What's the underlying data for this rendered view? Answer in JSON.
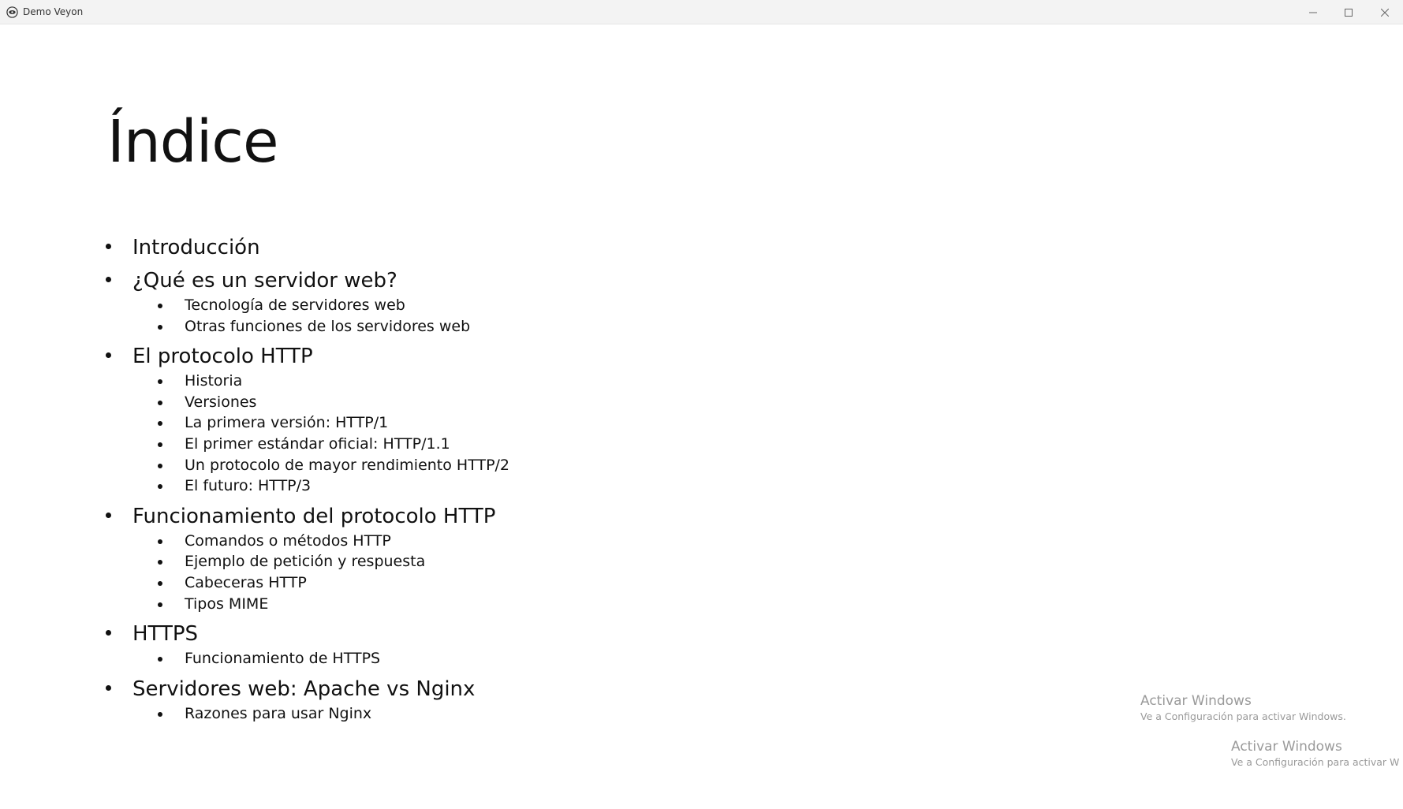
{
  "window": {
    "title": "Demo Veyon",
    "controls": {
      "minimize_icon": "minimize-icon",
      "maximize_icon": "maximize-icon",
      "close_icon": "close-icon"
    }
  },
  "slide": {
    "title": "Índice",
    "items": [
      {
        "label": "Introducción",
        "children": []
      },
      {
        "label": "¿Qué es un servidor web?",
        "children": [
          "Tecnología de servidores web",
          "Otras funciones de los servidores web"
        ]
      },
      {
        "label": "El protocolo HTTP",
        "children": [
          "Historia",
          "Versiones",
          "La primera versión: HTTP/1",
          "El primer estándar oficial: HTTP/1.1",
          "Un protocolo de mayor rendimiento HTTP/2",
          "El futuro: HTTP/3"
        ]
      },
      {
        "label": "Funcionamiento del protocolo HTTP",
        "children": [
          "Comandos o métodos HTTP",
          "Ejemplo de petición y respuesta",
          "Cabeceras HTTP",
          "Tipos MIME"
        ]
      },
      {
        "label": "HTTPS",
        "children": [
          "Funcionamiento de HTTPS"
        ]
      },
      {
        "label": "Servidores web: Apache vs Nginx",
        "children": [
          "Razones para usar Nginx"
        ]
      }
    ]
  },
  "watermarks": [
    {
      "title": "Activar Windows",
      "subtitle": "Ve a Configuración para activar Windows."
    },
    {
      "title": "Activar Windows",
      "subtitle": "Ve a Configuración para activar W"
    }
  ]
}
